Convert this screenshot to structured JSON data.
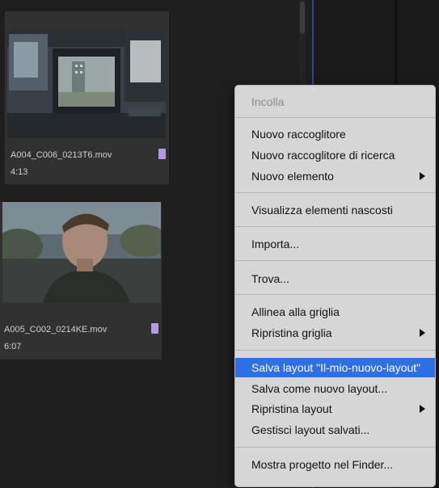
{
  "project": {
    "clips": [
      {
        "name": "A004_C006_0213T6.mov",
        "duration": "4:13"
      },
      {
        "name": "A005_C002_0214KE.mov",
        "duration": "6:07"
      }
    ]
  },
  "colors": {
    "label_swatch": "#b49ae0",
    "menu_bg": "#d6d6d6",
    "menu_highlight": "#2f6fe4"
  },
  "context_menu": {
    "paste": "Incolla",
    "new_bin": "Nuovo raccoglitore",
    "new_search_bin": "Nuovo raccoglitore di ricerca",
    "new_item": "Nuovo elemento",
    "show_hidden": "Visualizza elementi nascosti",
    "import": "Importa...",
    "find": "Trova...",
    "align_grid": "Allinea alla griglia",
    "reset_grid": "Ripristina griglia",
    "save_layout": "Salva layout \"Il-mio-nuovo-layout\"",
    "save_new_layout": "Salva come nuovo layout...",
    "reset_layout": "Ripristina layout",
    "manage_layouts": "Gestisci layout salvati...",
    "reveal_in_finder": "Mostra progetto nel Finder..."
  }
}
